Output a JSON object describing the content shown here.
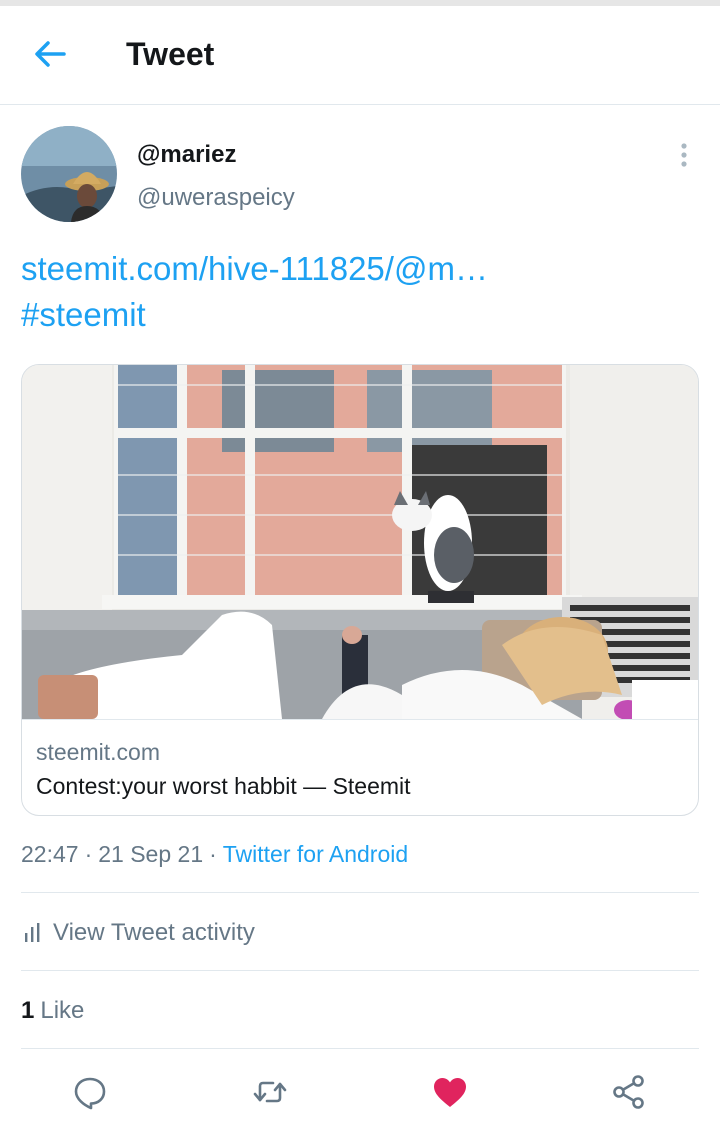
{
  "header": {
    "title": "Tweet"
  },
  "user": {
    "display_name": "@mariez",
    "handle": "@uweraspeicy"
  },
  "tweet": {
    "link_text": "steemit.com/hive-111825/@m…",
    "hashtag": "#steemit"
  },
  "card": {
    "domain": "steemit.com",
    "title": "Contest:your worst habbit — Steemit"
  },
  "meta": {
    "time": "22:47",
    "date": "21 Sep 21",
    "separator": "·",
    "source": "Twitter for Android"
  },
  "activity": {
    "label": "View Tweet activity"
  },
  "likes": {
    "count": "1",
    "label": "Like"
  },
  "colors": {
    "accent": "#1da1f2",
    "like": "#e0245e",
    "muted": "#657786",
    "text": "#14171a"
  },
  "icons": [
    "back-arrow-icon",
    "more-vertical-icon",
    "bar-chart-icon",
    "reply-icon",
    "retweet-icon",
    "heart-icon",
    "share-icon"
  ]
}
